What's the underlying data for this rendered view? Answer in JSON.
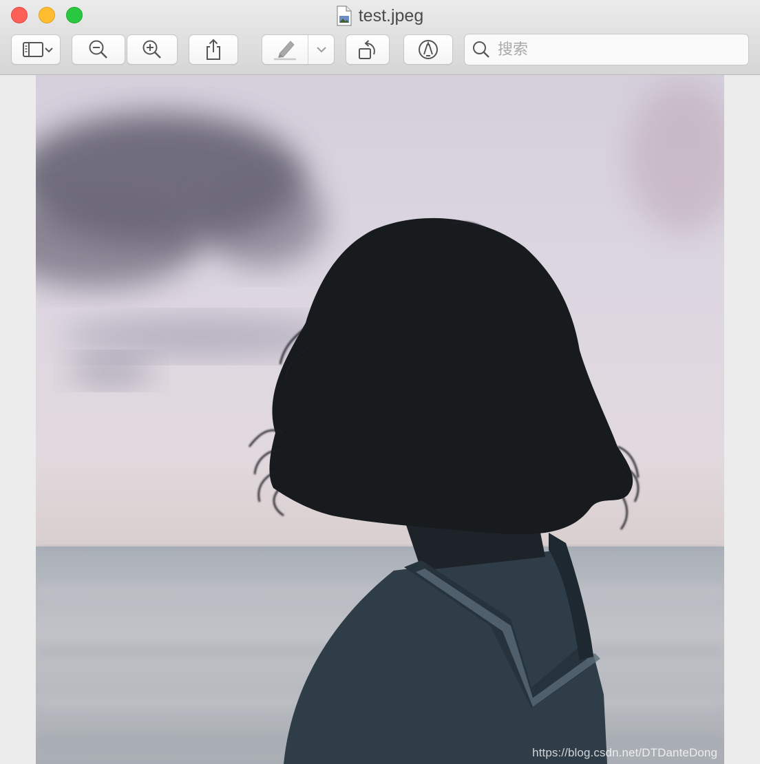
{
  "window": {
    "title": "test.jpeg"
  },
  "toolbar": {
    "buttons": [
      {
        "icon": "sidebar-toggle-icon"
      },
      {
        "icon": "zoom-out-icon"
      },
      {
        "icon": "zoom-in-icon"
      },
      {
        "icon": "share-icon"
      },
      {
        "icon": "highlight-pen-icon"
      },
      {
        "icon": "rotate-left-icon"
      },
      {
        "icon": "markup-icon"
      }
    ],
    "search_placeholder": "搜索"
  },
  "content": {
    "watermark": "https://blog.csdn.net/DTDanteDong"
  },
  "colors": {
    "close": "#fe5f57",
    "minimize": "#febc2e",
    "maximize": "#28c840"
  }
}
